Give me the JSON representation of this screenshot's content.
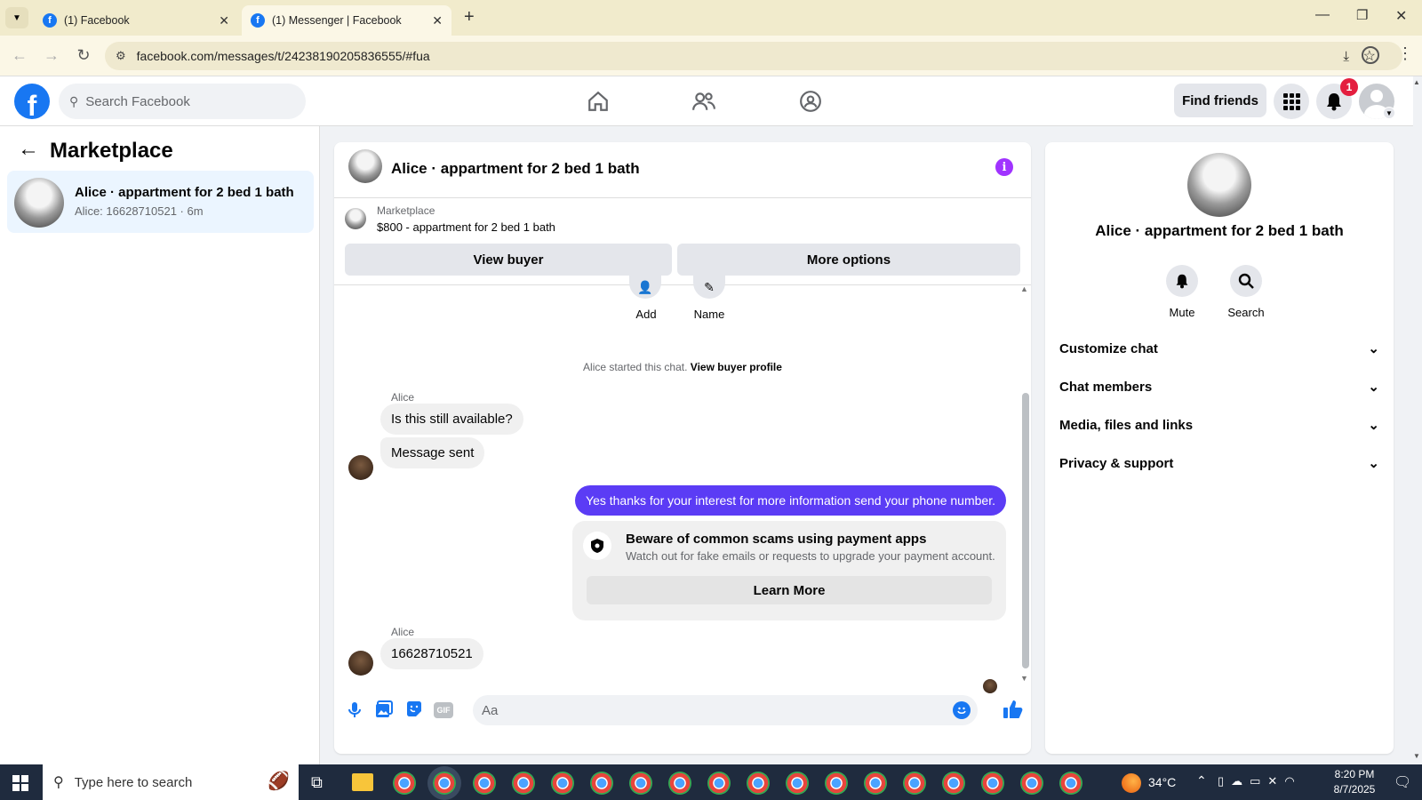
{
  "browser": {
    "tabs": [
      {
        "title": "(1) Facebook",
        "active": false
      },
      {
        "title": "(1) Messenger | Facebook",
        "active": true
      }
    ],
    "url": "facebook.com/messages/t/24238190205836555/#fua"
  },
  "fb": {
    "search_placeholder": "Search Facebook",
    "find_friends": "Find friends",
    "notification_count": "1"
  },
  "left": {
    "title": "Marketplace",
    "conversation": {
      "name": "Alice · appartment for 2 bed 1 bath",
      "preview": "Alice: 16628710521 · 6m"
    }
  },
  "chat": {
    "header_title": "Alice · appartment for 2 bed 1 bath",
    "listing_source": "Marketplace",
    "listing_title": "$800 - appartment for 2 bed 1 bath",
    "view_buyer": "View buyer",
    "more_options": "More options",
    "add_label": "Add",
    "name_label": "Name",
    "started_text": "Alice started this chat.",
    "view_buyer_profile": "View buyer profile",
    "sender_name_1": "Alice",
    "msg_1": "Is this still available?",
    "msg_2": "Message sent",
    "msg_out": "Yes thanks for your interest for more information send your phone number.",
    "scam_title": "Beware of common scams using payment apps",
    "scam_body": "Watch out for fake emails or requests to upgrade your payment account.",
    "learn_more": "Learn More",
    "sender_name_2": "Alice",
    "msg_3": "16628710521",
    "composer_placeholder": "Aa",
    "accent": "#5b3cf5"
  },
  "right": {
    "name": "Alice · appartment for 2 bed 1 bath",
    "mute": "Mute",
    "search": "Search",
    "sections": [
      "Customize chat",
      "Chat members",
      "Media, files and links",
      "Privacy & support"
    ]
  },
  "taskbar": {
    "search_placeholder": "Type here to search",
    "temperature": "34°C",
    "time": "8:20 PM",
    "date": "8/7/2025"
  }
}
